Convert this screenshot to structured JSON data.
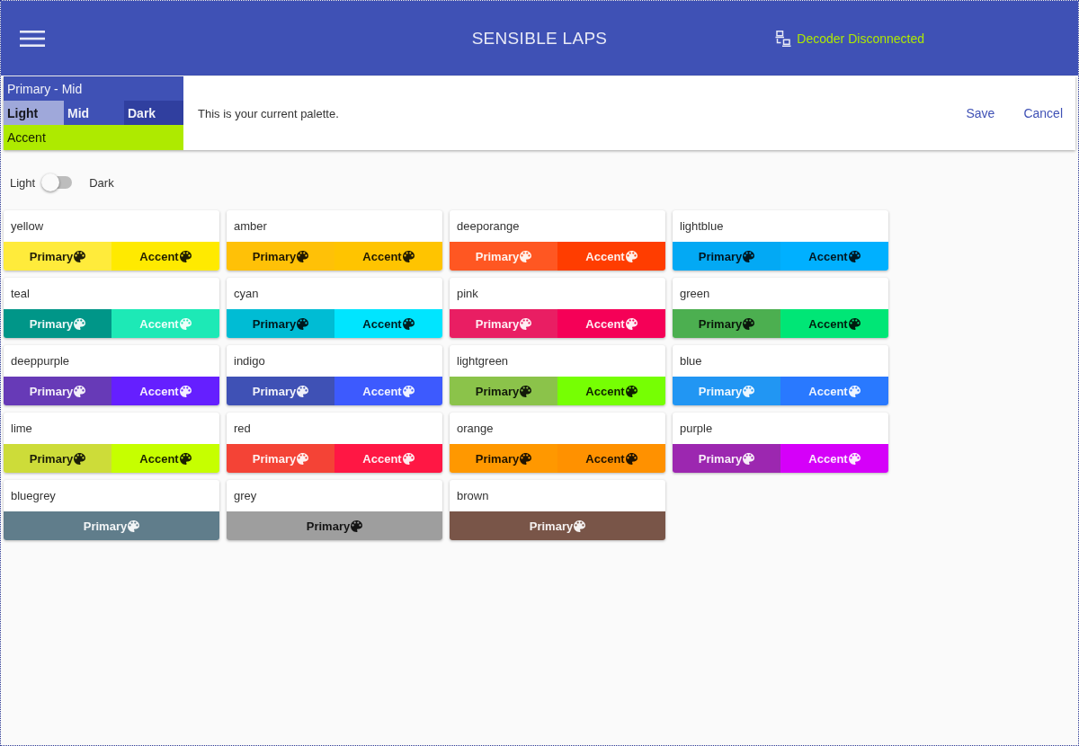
{
  "app_bar": {
    "title": "SENSIBLE LAPS",
    "status": "Decoder Disconnected"
  },
  "current_palette": {
    "primary": {
      "label": "Primary - Mid",
      "color": "#3f51b5",
      "light_text": true
    },
    "shades": [
      {
        "label": "Light",
        "color": "#9fa8da",
        "light_text": false
      },
      {
        "label": "Mid",
        "color": "#3f51b5",
        "light_text": true
      },
      {
        "label": "Dark",
        "color": "#303f9f",
        "light_text": true
      }
    ],
    "accent": {
      "label": "Accent",
      "color": "#aeea00",
      "light_text": false
    },
    "message": "This is your current palette.",
    "buttons": [
      "Save",
      "Cancel"
    ]
  },
  "theme_toggle": {
    "left_label": "Light",
    "right_label": "Dark",
    "on": false
  },
  "palettes": [
    {
      "name": "yellow",
      "swatches": [
        {
          "label": "Primary",
          "color": "#ffeb3b",
          "light_text": false
        },
        {
          "label": "Accent",
          "color": "#ffea00",
          "light_text": false
        }
      ]
    },
    {
      "name": "amber",
      "swatches": [
        {
          "label": "Primary",
          "color": "#ffc107",
          "light_text": false
        },
        {
          "label": "Accent",
          "color": "#ffc400",
          "light_text": false
        }
      ]
    },
    {
      "name": "deeporange",
      "swatches": [
        {
          "label": "Primary",
          "color": "#ff5722",
          "light_text": true
        },
        {
          "label": "Accent",
          "color": "#ff3d00",
          "light_text": true
        }
      ]
    },
    {
      "name": "lightblue",
      "swatches": [
        {
          "label": "Primary",
          "color": "#03a9f4",
          "light_text": false
        },
        {
          "label": "Accent",
          "color": "#00b0ff",
          "light_text": false
        }
      ]
    },
    {
      "name": "teal",
      "swatches": [
        {
          "label": "Primary",
          "color": "#009688",
          "light_text": true
        },
        {
          "label": "Accent",
          "color": "#1de9b6",
          "light_text": true
        }
      ]
    },
    {
      "name": "cyan",
      "swatches": [
        {
          "label": "Primary",
          "color": "#00bcd4",
          "light_text": false
        },
        {
          "label": "Accent",
          "color": "#00e5ff",
          "light_text": false
        }
      ]
    },
    {
      "name": "pink",
      "swatches": [
        {
          "label": "Primary",
          "color": "#e91e63",
          "light_text": true
        },
        {
          "label": "Accent",
          "color": "#f50057",
          "light_text": true
        }
      ]
    },
    {
      "name": "green",
      "swatches": [
        {
          "label": "Primary",
          "color": "#4caf50",
          "light_text": false
        },
        {
          "label": "Accent",
          "color": "#00e676",
          "light_text": false
        }
      ]
    },
    {
      "name": "deeppurple",
      "swatches": [
        {
          "label": "Primary",
          "color": "#673ab7",
          "light_text": true
        },
        {
          "label": "Accent",
          "color": "#651fff",
          "light_text": true
        }
      ]
    },
    {
      "name": "indigo",
      "swatches": [
        {
          "label": "Primary",
          "color": "#3f51b5",
          "light_text": true
        },
        {
          "label": "Accent",
          "color": "#3d5afe",
          "light_text": true
        }
      ]
    },
    {
      "name": "lightgreen",
      "swatches": [
        {
          "label": "Primary",
          "color": "#8bc34a",
          "light_text": false
        },
        {
          "label": "Accent",
          "color": "#76ff03",
          "light_text": false
        }
      ]
    },
    {
      "name": "blue",
      "swatches": [
        {
          "label": "Primary",
          "color": "#2196f3",
          "light_text": true
        },
        {
          "label": "Accent",
          "color": "#2979ff",
          "light_text": true
        }
      ]
    },
    {
      "name": "lime",
      "swatches": [
        {
          "label": "Primary",
          "color": "#cddc39",
          "light_text": false
        },
        {
          "label": "Accent",
          "color": "#c6ff00",
          "light_text": false
        }
      ]
    },
    {
      "name": "red",
      "swatches": [
        {
          "label": "Primary",
          "color": "#f44336",
          "light_text": true
        },
        {
          "label": "Accent",
          "color": "#ff1744",
          "light_text": true
        }
      ]
    },
    {
      "name": "orange",
      "swatches": [
        {
          "label": "Primary",
          "color": "#ff9800",
          "light_text": false
        },
        {
          "label": "Accent",
          "color": "#ff9100",
          "light_text": false
        }
      ]
    },
    {
      "name": "purple",
      "swatches": [
        {
          "label": "Primary",
          "color": "#9c27b0",
          "light_text": true
        },
        {
          "label": "Accent",
          "color": "#d500f9",
          "light_text": true
        }
      ]
    },
    {
      "name": "bluegrey",
      "swatches": [
        {
          "label": "Primary",
          "color": "#607d8b",
          "light_text": true
        }
      ]
    },
    {
      "name": "grey",
      "swatches": [
        {
          "label": "Primary",
          "color": "#9e9e9e",
          "light_text": false
        }
      ]
    },
    {
      "name": "brown",
      "swatches": [
        {
          "label": "Primary",
          "color": "#795548",
          "light_text": true
        }
      ]
    }
  ]
}
